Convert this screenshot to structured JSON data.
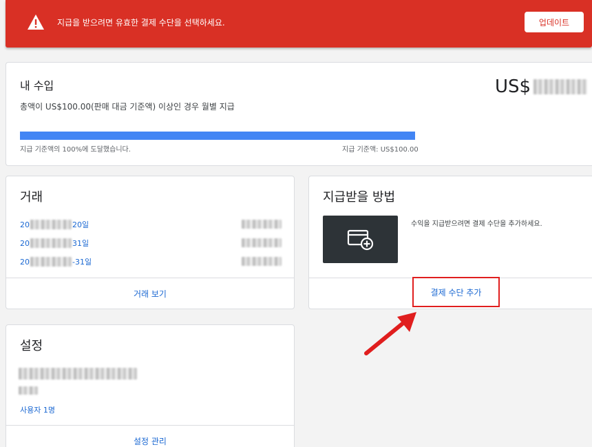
{
  "banner": {
    "message": "지급을 받으려면 유효한 결제 수단을 선택하세요.",
    "update_label": "업데이트",
    "icon": "warning-icon",
    "color": "#d93025"
  },
  "earnings": {
    "title": "내 수입",
    "description": "총액이 US$100.00(판매 대금 기준액) 이상인 경우 월별 지급",
    "amount_prefix": "US$",
    "progress_percent": 100,
    "progress_left_label": "지급 기준액의 100%에 도달했습니다.",
    "progress_right_label": "지급 기준액: US$100.00",
    "progress_color": "#4285f4"
  },
  "transactions": {
    "title": "거래",
    "rows": [
      {
        "date_prefix": "20",
        "date_suffix": "20일"
      },
      {
        "date_prefix": "20",
        "date_suffix": "31일"
      },
      {
        "date_prefix": "20",
        "date_suffix": "-31일"
      }
    ],
    "action_label": "거래 보기"
  },
  "payment": {
    "title": "지급받을 방법",
    "description": "수익을 지급받으려면 결제 수단을 추가하세요.",
    "add_label": "결제 수단 추가",
    "icon": "add-card-icon",
    "highlight_color": "#e01e1e"
  },
  "settings": {
    "title": "설정",
    "users_label": "사용자 1명",
    "action_label": "설정 관리"
  },
  "accent_link_color": "#1967d2"
}
